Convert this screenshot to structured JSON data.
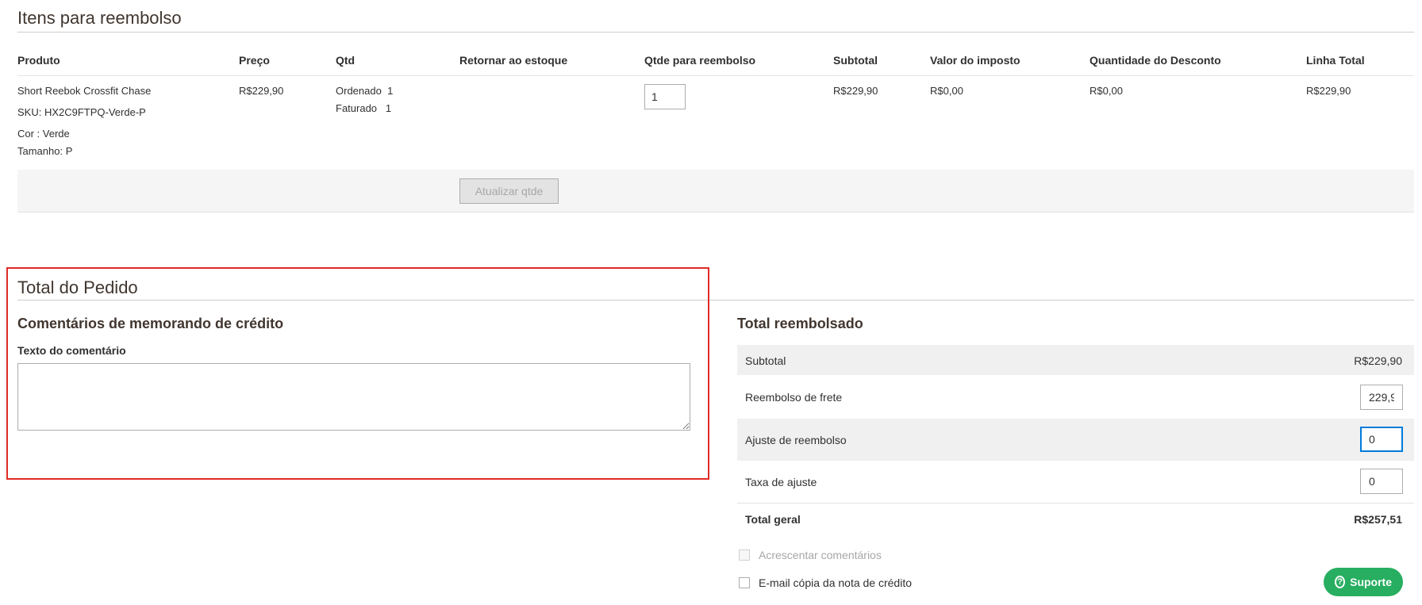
{
  "items_section": {
    "title": "Itens para reembolso",
    "columns": [
      "Produto",
      "Preço",
      "Qtd",
      "Retornar ao estoque",
      "Qtde para reembolso",
      "Subtotal",
      "Valor do imposto",
      "Quantidade do Desconto",
      "Linha Total"
    ],
    "row": {
      "product_name": "Short Reebok Crossfit Chase",
      "sku": "SKU: HX2C9FTPQ-Verde-P",
      "color_label": "Cor :",
      "color_value": "Verde",
      "size_label": "Tamanho:",
      "size_value": "P",
      "price": "R$229,90",
      "ordered_label": "Ordenado",
      "ordered_value": "1",
      "invoiced_label": "Faturado",
      "invoiced_value": "1",
      "refund_qty": "1",
      "subtotal": "R$229,90",
      "tax": "R$0,00",
      "discount": "R$0,00",
      "row_total": "R$229,90"
    },
    "update_qty_button": "Atualizar qtde"
  },
  "order_total": {
    "title": "Total do Pedido",
    "comments": {
      "title": "Comentários de memorando de crédito",
      "field_label": "Texto do comentário",
      "value": ""
    },
    "refund_totals": {
      "title": "Total reembolsado",
      "subtotal_label": "Subtotal",
      "subtotal_value": "R$229,90",
      "shipping_label": "Reembolso de frete",
      "shipping_value": "229,9",
      "adjustment_refund_label": "Ajuste de reembolso",
      "adjustment_refund_value": "0",
      "adjustment_fee_label": "Taxa de ajuste",
      "adjustment_fee_value": "0",
      "grand_total_label": "Total geral",
      "grand_total_value": "R$257,51"
    },
    "append_comments_label": "Acrescentar comentários",
    "email_copy_label": "E-mail cópia da nota de crédito"
  },
  "support": {
    "label": "Suporte",
    "icon": "question-circle-icon",
    "color": "#27ae60"
  },
  "colors": {
    "highlight": "#e02b27",
    "focus": "#007bdb"
  }
}
